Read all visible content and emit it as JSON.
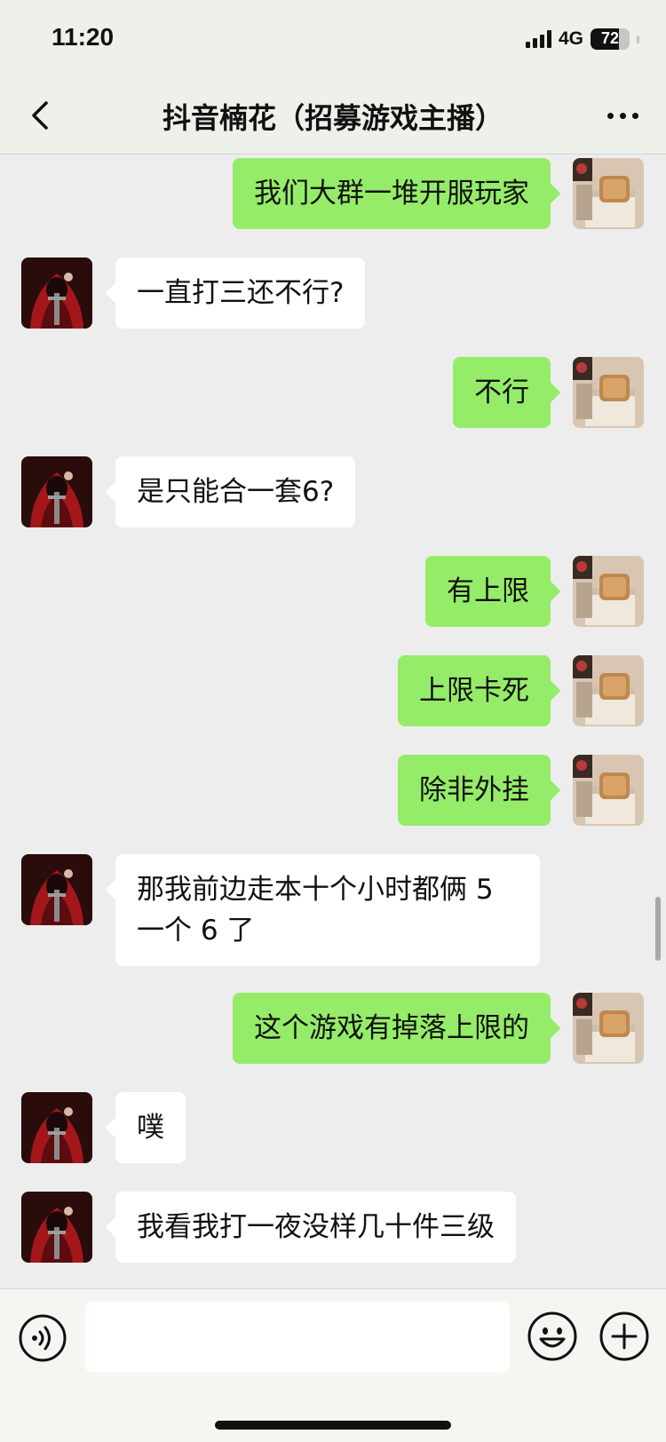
{
  "status_bar": {
    "time": "11:20",
    "network": "4G",
    "battery": "72",
    "battery_level": 0.72
  },
  "nav": {
    "title": "抖音楠花（招募游戏主播）",
    "back_icon": "chevron-left-icon",
    "more_icon": "ellipsis-icon"
  },
  "messages": [
    {
      "side": "out",
      "text": "我们大群一堆开服玩家"
    },
    {
      "side": "in",
      "text": "一直打三还不行?"
    },
    {
      "side": "out",
      "text": "不行"
    },
    {
      "side": "in",
      "text": "是只能合一套6?"
    },
    {
      "side": "out",
      "text": "有上限"
    },
    {
      "side": "out",
      "text": "上限卡死"
    },
    {
      "side": "out",
      "text": "除非外挂"
    },
    {
      "side": "in",
      "text": "那我前边走本十个小时都俩 5 一个 6 了"
    },
    {
      "side": "out",
      "text": "这个游戏有掉落上限的"
    },
    {
      "side": "in",
      "text": "噗"
    },
    {
      "side": "in",
      "text": "我看我打一夜没样几十件三级"
    }
  ],
  "input_bar": {
    "placeholder": "",
    "value": "",
    "voice_icon": "voice-icon",
    "emoji_icon": "emoji-icon",
    "plus_icon": "plus-icon"
  },
  "colors": {
    "outgoing_bubble": "#95ec69",
    "incoming_bubble": "#ffffff",
    "background": "#ededed"
  }
}
